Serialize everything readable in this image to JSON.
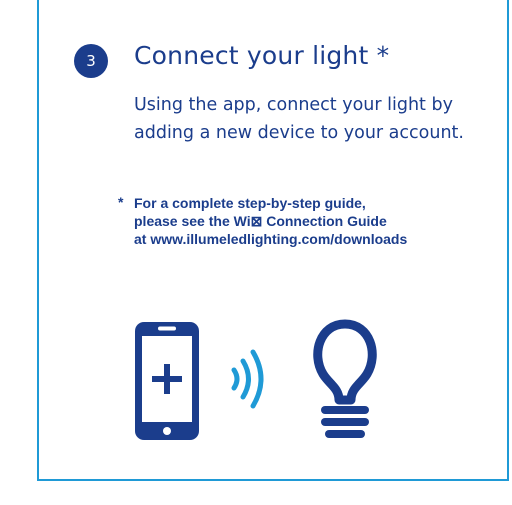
{
  "step": {
    "number": "3",
    "title": "Connect your light *",
    "body": "Using the app, connect your light by adding a new device to your account."
  },
  "note": {
    "marker": "*",
    "lines": [
      "For a complete step-by-step guide,",
      "please see the Wi⊠ Connection Guide",
      "at www.illumeledlighting.com/downloads"
    ]
  },
  "illustration": {
    "icons": [
      "smartphone-plus-icon",
      "wifi-waves-icon",
      "light-bulb-icon"
    ]
  },
  "colors": {
    "navy": "#1b3d8c",
    "accent_blue": "#1f9ad6",
    "frame_blue": "#1f9ad6",
    "background": "#ffffff"
  }
}
